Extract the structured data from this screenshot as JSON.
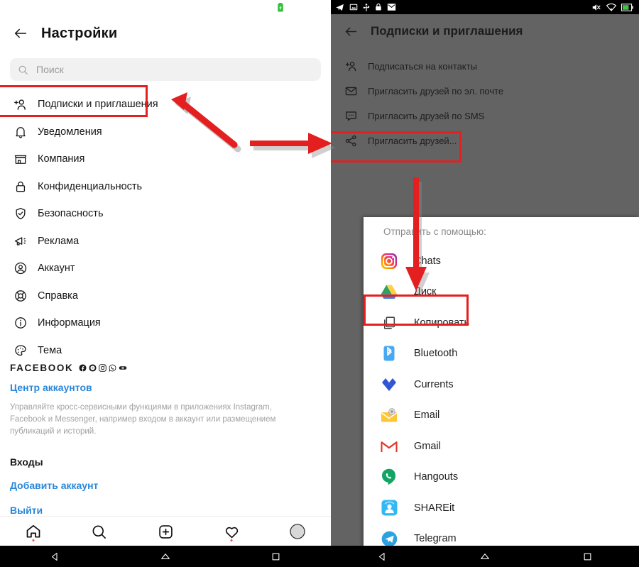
{
  "left_phone": {
    "status_bar": {
      "battery_icon": "battery-charging-icon"
    },
    "appbar": {
      "back_icon": "back-arrow-icon",
      "title": "Настройки"
    },
    "search": {
      "icon": "search-icon",
      "placeholder": "Поиск"
    },
    "menu": [
      {
        "icon": "add-person-icon",
        "label": "Подписки и приглашения",
        "highlighted": true
      },
      {
        "icon": "bell-icon",
        "label": "Уведомления"
      },
      {
        "icon": "store-icon",
        "label": "Компания"
      },
      {
        "icon": "lock-icon",
        "label": "Конфиденциальность"
      },
      {
        "icon": "shield-check-icon",
        "label": "Безопасность"
      },
      {
        "icon": "megaphone-icon",
        "label": "Реклама"
      },
      {
        "icon": "account-circle-icon",
        "label": "Аккаунт"
      },
      {
        "icon": "lifebuoy-icon",
        "label": "Справка"
      },
      {
        "icon": "info-icon",
        "label": "Информация"
      },
      {
        "icon": "palette-icon",
        "label": "Тема"
      }
    ],
    "facebook_section": {
      "heading": "FACEBOOK",
      "brand_icons": [
        "facebook-icon",
        "messenger-icon",
        "instagram-icon",
        "whatsapp-icon",
        "oculus-icon"
      ],
      "accounts_center_link": "Центр аккаунтов",
      "description": "Управляйте кросс-сервисными функциями в приложениях Instagram, Facebook и Messenger, например входом в аккаунт или размещением публикаций и историй.",
      "logins_heading": "Входы",
      "add_account_link": "Добавить аккаунт",
      "logout_link": "Выйти"
    },
    "tabbar": [
      {
        "icon": "home-icon",
        "badge": true
      },
      {
        "icon": "search-icon",
        "badge": false
      },
      {
        "icon": "add-post-icon",
        "badge": false
      },
      {
        "icon": "heart-icon",
        "badge": true
      },
      {
        "icon": "profile-avatar-icon",
        "badge": false
      }
    ],
    "navbar": [
      {
        "icon": "android-back-icon"
      },
      {
        "icon": "android-home-icon"
      },
      {
        "icon": "android-recents-icon"
      }
    ]
  },
  "right_phone": {
    "status_bar": {
      "left_icons": [
        "telegram-icon",
        "screenshot-icon",
        "usb-icon",
        "lock-icon",
        "email-icon"
      ],
      "right_icons": [
        "mute-icon",
        "wifi-icon",
        "battery-icon"
      ]
    },
    "appbar": {
      "back_icon": "back-arrow-icon",
      "title": "Подписки и приглашения"
    },
    "menu": [
      {
        "icon": "add-person-icon",
        "label": "Подписаться на контакты"
      },
      {
        "icon": "envelope-icon",
        "label": "Пригласить друзей по эл. почте"
      },
      {
        "icon": "chat-bubble-icon",
        "label": "Пригласить друзей по SMS"
      },
      {
        "icon": "share-icon",
        "label": "Пригласить друзей...",
        "highlighted": true
      }
    ],
    "share_sheet": {
      "title": "Отправить с помощью:",
      "items": [
        {
          "icon": "instagram-icon",
          "label": "Chats"
        },
        {
          "icon": "google-drive-icon",
          "label": "Диск"
        },
        {
          "icon": "copy-icon",
          "label": "Копировать",
          "highlighted": true
        },
        {
          "icon": "bluetooth-icon",
          "label": "Bluetooth"
        },
        {
          "icon": "currents-icon",
          "label": "Currents"
        },
        {
          "icon": "email-icon",
          "label": "Email"
        },
        {
          "icon": "gmail-icon",
          "label": "Gmail"
        },
        {
          "icon": "hangouts-icon",
          "label": "Hangouts"
        },
        {
          "icon": "shareit-icon",
          "label": "SHAREit"
        },
        {
          "icon": "telegram-icon",
          "label": "Telegram"
        }
      ]
    },
    "navbar": [
      {
        "icon": "android-back-icon"
      },
      {
        "icon": "android-home-icon"
      },
      {
        "icon": "android-recents-icon"
      }
    ]
  },
  "annotations": {
    "accent_color": "#e41f1f",
    "arrows": [
      {
        "name": "arrow-to-subscriptions",
        "direction": "up-left"
      },
      {
        "name": "arrow-to-invite-friends",
        "direction": "right"
      },
      {
        "name": "arrow-to-copy",
        "direction": "down"
      }
    ]
  }
}
